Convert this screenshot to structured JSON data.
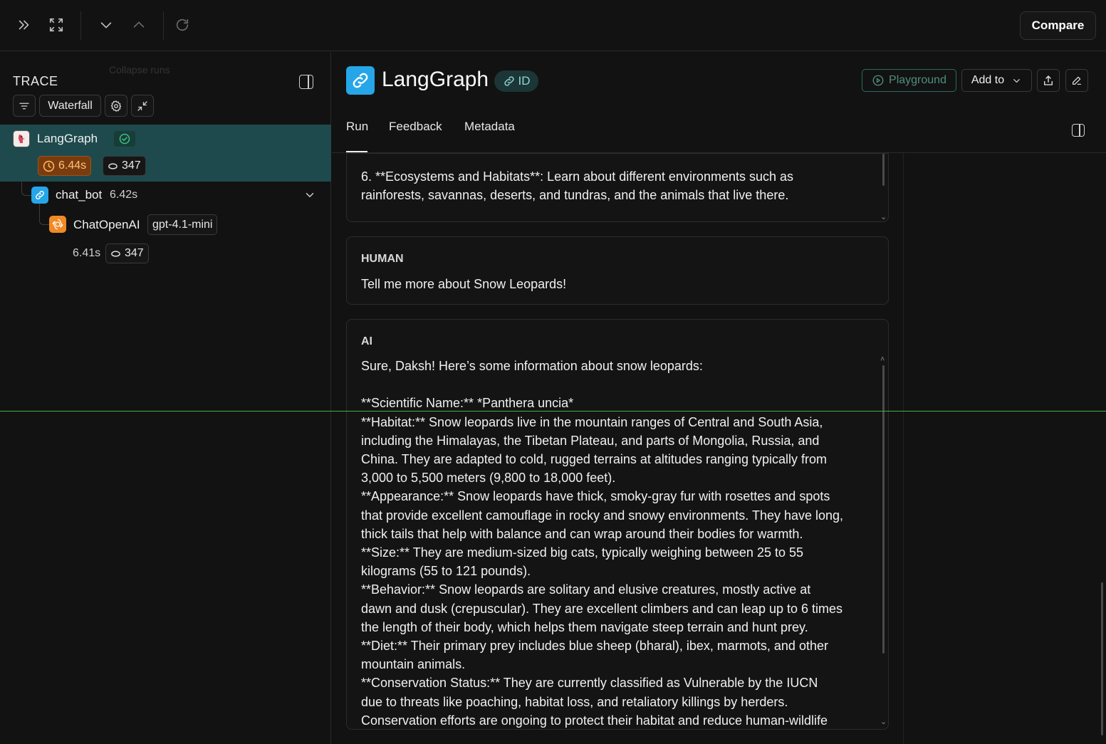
{
  "topbar": {
    "compare_label": "Compare",
    "icons": [
      "expand-panel-icon",
      "fullscreen-icon",
      "chevron-down-icon",
      "chevron-up-icon",
      "refresh-icon"
    ],
    "collapse_tooltip": "Collapse runs"
  },
  "trace": {
    "title": "TRACE",
    "waterfall_label": "Waterfall",
    "nodes": [
      {
        "name": "LangGraph",
        "duration": "6.44s",
        "tokens": "347",
        "status": "success"
      },
      {
        "name": "chat_bot",
        "duration": "6.42s"
      },
      {
        "name": "ChatOpenAI",
        "model": "gpt-4.1-mini",
        "duration": "6.41s",
        "tokens": "347"
      }
    ]
  },
  "header": {
    "title": "LangGraph",
    "id_label": "ID",
    "playground_label": "Playground",
    "add_to_label": "Add to"
  },
  "tabs": [
    "Run",
    "Feedback",
    "Metadata"
  ],
  "messages": [
    {
      "role": "",
      "text": "6. **Ecosystems and Habitats**: Learn about different environments such as\nrainforests, savannas, deserts, and tundras, and the animals that live there."
    },
    {
      "role": "HUMAN",
      "text": "Tell me more about Snow Leopards!"
    },
    {
      "role": "AI",
      "text": "Sure, Daksh! Here’s some information about snow leopards:\n\n**Scientific Name:** *Panthera uncia*\n**Habitat:** Snow leopards live in the mountain ranges of Central and South Asia,\nincluding the Himalayas, the Tibetan Plateau, and parts of Mongolia, Russia, and\nChina. They are adapted to cold, rugged terrains at altitudes ranging typically from\n3,000 to 5,500 meters (9,800 to 18,000 feet).\n**Appearance:** Snow leopards have thick, smoky-gray fur with rosettes and spots\nthat provide excellent camouflage in rocky and snowy environments. They have long,\nthick tails that help with balance and can wrap around their bodies for warmth.\n**Size:** They are medium-sized big cats, typically weighing between 25 to 55\nkilograms (55 to 121 pounds).\n**Behavior:** Snow leopards are solitary and elusive creatures, mostly active at\ndawn and dusk (crepuscular). They are excellent climbers and can leap up to 6 times\nthe length of their body, which helps them navigate steep terrain and hunt prey.\n**Diet:** Their primary prey includes blue sheep (bharal), ibex, marmots, and other\nmountain animals.\n**Conservation Status:** They are currently classified as Vulnerable by the IUCN\ndue to threats like poaching, habitat loss, and retaliatory killings by herders.\nConservation efforts are ongoing to protect their habitat and reduce human-wildlife"
    }
  ],
  "colors": {
    "selected_row": "#1e4a4d",
    "time_badge": "#7a3c0e",
    "langgraph_blue": "#26a6e8",
    "openai_orange": "#f08a24",
    "success_green": "#2f9e72"
  }
}
